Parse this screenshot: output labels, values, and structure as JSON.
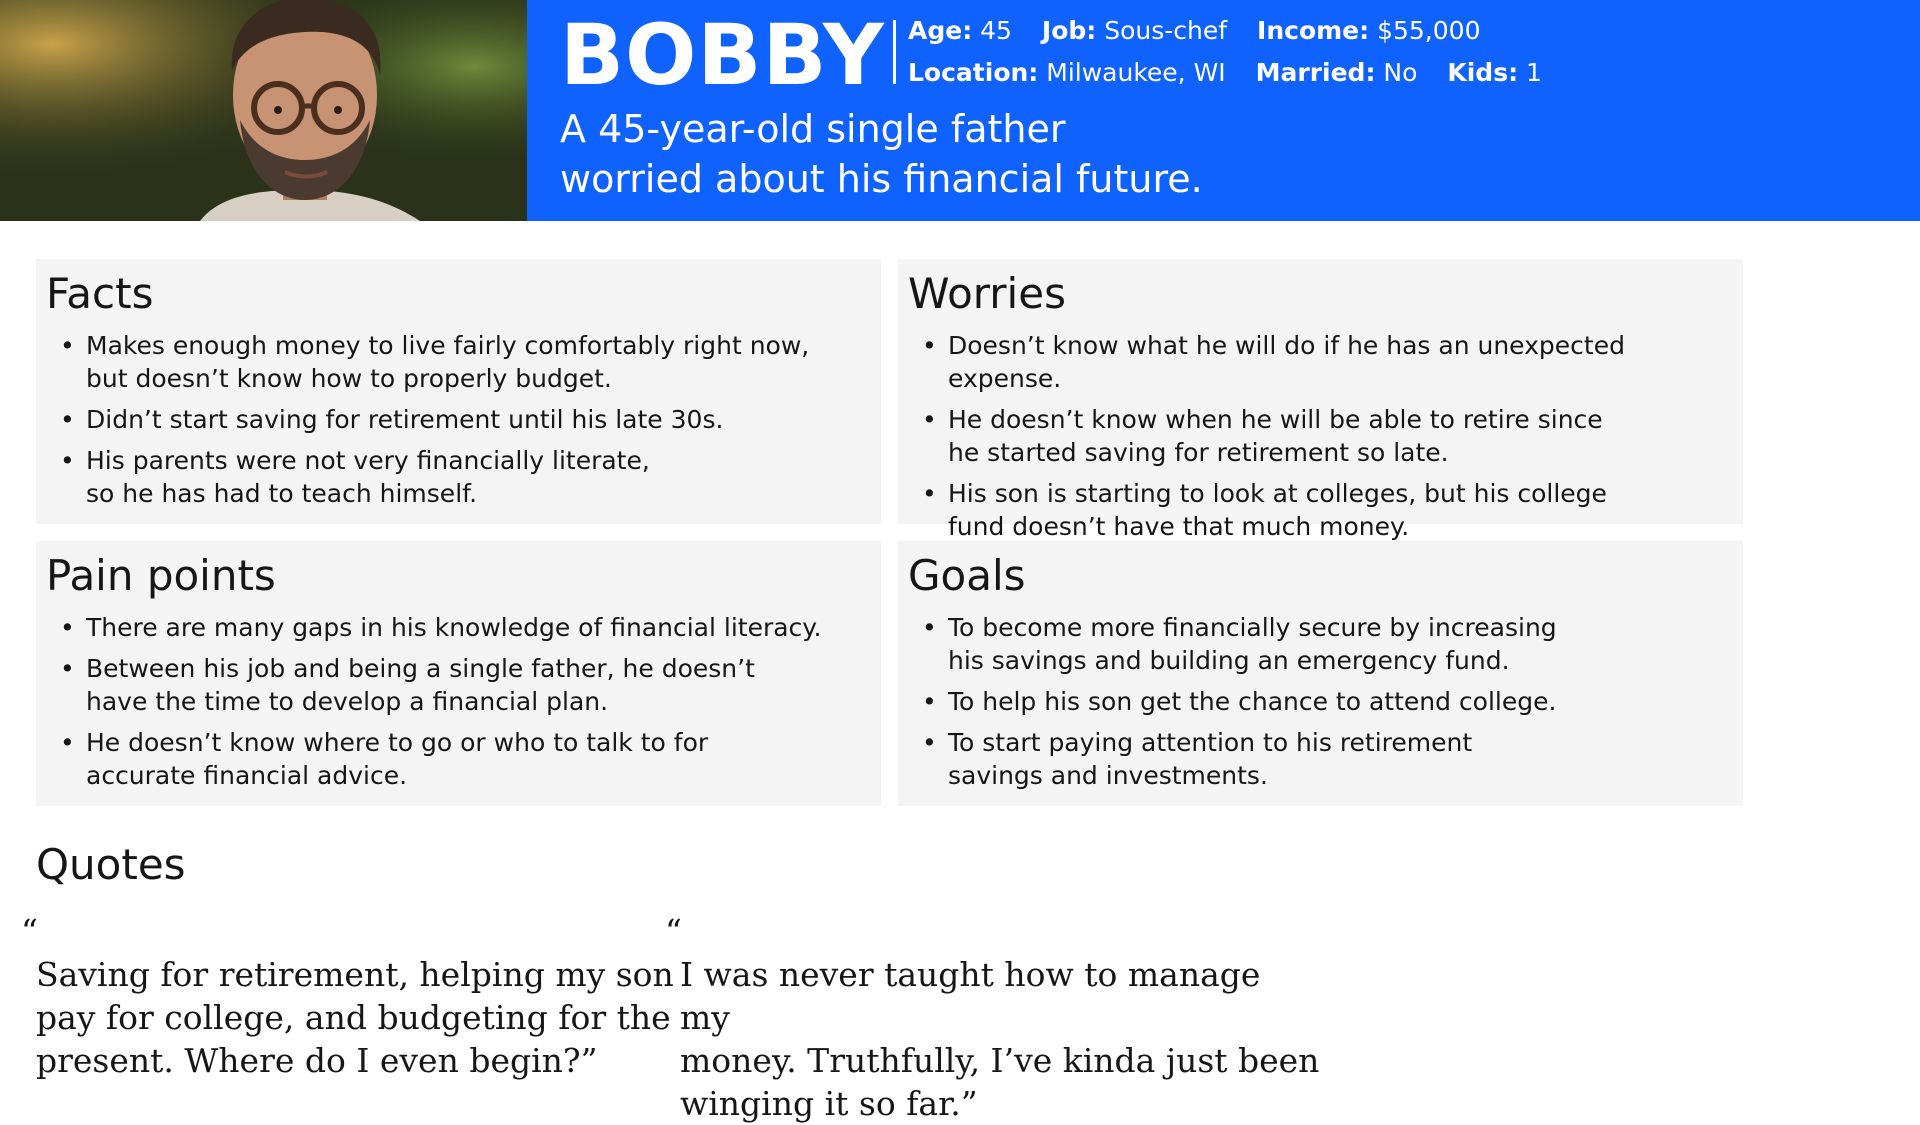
{
  "persona": {
    "name": "BOBBY",
    "meta_row1": [
      {
        "label": "Age:",
        "value": "45"
      },
      {
        "label": "Job:",
        "value": "Sous-chef"
      },
      {
        "label": "Income:",
        "value": "$55,000"
      }
    ],
    "meta_row2": [
      {
        "label": "Location:",
        "value": "Milwaukee, WI"
      },
      {
        "label": "Married:",
        "value": "No"
      },
      {
        "label": "Kids:",
        "value": "1"
      }
    ],
    "tagline": "A 45-year-old single father\nworried about his financial future."
  },
  "cards": {
    "facts": {
      "title": "Facts",
      "items": [
        "Makes enough money to live fairly comfortably right now,\nbut doesn’t know how to properly budget.",
        "Didn’t start saving for retirement until his late 30s.",
        "His parents were not very financially literate,\nso he has had to teach himself."
      ]
    },
    "worries": {
      "title": "Worries",
      "items": [
        "Doesn’t know what he will do if he has an unexpected expense.",
        "He doesn’t know when he will be able to retire since\nhe started saving for retirement so late.",
        "His son is starting to look at colleges, but his college\nfund doesn’t have that much money."
      ]
    },
    "pain_points": {
      "title": "Pain points",
      "items": [
        "There are many gaps in his knowledge of financial literacy.",
        "Between his job and being a single father, he doesn’t\nhave the time to develop a financial plan.",
        "He doesn’t know where to go or who to talk to for\naccurate financial advice."
      ]
    },
    "goals": {
      "title": "Goals",
      "items": [
        "To become more financially secure by increasing\nhis savings and building an emergency fund.",
        "To help his son get the chance to attend college.",
        "To start paying attention to his retirement\nsavings and investments."
      ]
    }
  },
  "quotes": {
    "title": "Quotes",
    "open_mark": "“",
    "items": [
      "Saving for retirement, helping my son\npay for college, and budgeting for the\npresent. Where do I even begin?”",
      "I was never taught how to manage my\nmoney. Truthfully, I’ve kinda just been\nwinging it so far.”"
    ]
  },
  "colors": {
    "banner": "#0f62fe",
    "card_background": "#f4f4f4",
    "text": "#161616"
  }
}
